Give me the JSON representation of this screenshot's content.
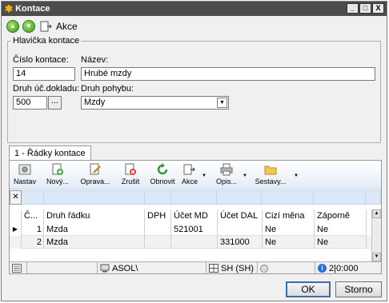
{
  "window": {
    "title": "Kontace",
    "controls": [
      "_",
      "□",
      "X"
    ]
  },
  "toolbar_top": {
    "akce_label": "Akce"
  },
  "header_group": {
    "legend": "Hlavička kontace",
    "cislo_label": "Číslo kontace:",
    "cislo_value": "14",
    "nazev_label": "Název:",
    "nazev_value": "Hrubé mzdy",
    "druh_uc_label": "Druh úč.dokladu:",
    "druh_uc_value": "500",
    "druh_uc_btn": "...",
    "druh_pohybu_label": "Druh pohybu:",
    "druh_pohybu_value": "Mzdy"
  },
  "tab": {
    "label": "1 - Řádky kontace"
  },
  "grid_toolbar": {
    "nastav": "Nastav",
    "novy": "Nový...",
    "oprava": "Oprava...",
    "zrusit": "Zrušit",
    "obnovit": "Obnovit",
    "akce": "Akce",
    "opis": "Opis...",
    "sestavy": "Sestavy..."
  },
  "grid": {
    "columns": [
      "Č...",
      "Druh řádku",
      "DPH",
      "Účet MD",
      "Účet DAL",
      "Cizí měna",
      "Záporně"
    ],
    "rows": [
      {
        "c": "1",
        "druh": "Mzda",
        "dph": "",
        "md": "521001",
        "dal": "",
        "cizi": "Ne",
        "zap": "Ne"
      },
      {
        "c": "2",
        "druh": "Mzda",
        "dph": "",
        "md": "",
        "dal": "331000",
        "cizi": "Ne",
        "zap": "Ne"
      }
    ]
  },
  "statusbar": {
    "user": "ASOL\\",
    "org": "SH (SH)",
    "info": "2|0:000"
  },
  "buttons": {
    "ok": "OK",
    "storno": "Storno"
  }
}
